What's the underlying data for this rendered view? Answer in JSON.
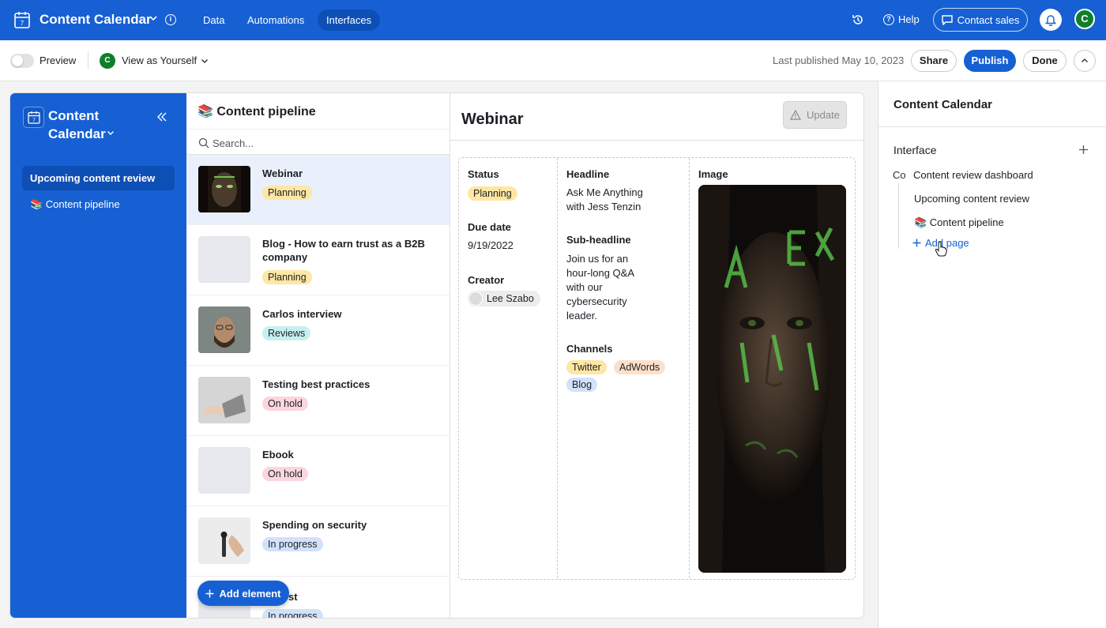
{
  "topbar": {
    "title": "Content Calendar",
    "nav": [
      "Data",
      "Automations",
      "Interfaces"
    ],
    "help_label": "Help",
    "contact_sales_label": "Contact sales",
    "avatar_initial": "C",
    "bg_color": "#1660d4"
  },
  "subbar": {
    "preview_label": "Preview",
    "avatar_initial": "C",
    "view_as_label": "View as Yourself",
    "last_published": "Last published May 10, 2023",
    "share_label": "Share",
    "publish_label": "Publish",
    "done_label": "Done"
  },
  "sidebar": {
    "title": "Content Calendar",
    "items": [
      {
        "label": "Upcoming content review",
        "active": true
      },
      {
        "label": "📚 Content pipeline",
        "active": false
      }
    ]
  },
  "list": {
    "title": "📚 Content pipeline",
    "search_placeholder": "Search...",
    "records": [
      {
        "name": "Webinar",
        "status": "Planning",
        "status_color": "#fde7a3",
        "thumb": "dark-face"
      },
      {
        "name": "Blog - How to earn trust as a B2B company",
        "status": "Planning",
        "status_color": "#fde7a3",
        "thumb": "placeholder"
      },
      {
        "name": "Carlos interview",
        "status": "Reviews",
        "status_color": "#c6f0ef",
        "thumb": "matrix-face"
      },
      {
        "name": "Testing best practices",
        "status": "On hold",
        "status_color": "#fbd6dd",
        "thumb": "laptop"
      },
      {
        "name": "Ebook",
        "status": "On hold",
        "status_color": "#fbd6dd",
        "thumb": "placeholder"
      },
      {
        "name": "Spending on security",
        "status": "In progress",
        "status_color": "#d1e2fb",
        "thumb": "key"
      },
      {
        "name": "st",
        "status": "In progress",
        "status_color": "#d1e2fb",
        "thumb": "placeholder"
      }
    ]
  },
  "add_element_label": "Add element",
  "detail": {
    "title": "Webinar",
    "update_label": "Update",
    "status_label": "Status",
    "status_value": "Planning",
    "due_date_label": "Due date",
    "due_date_value": "9/19/2022",
    "creator_label": "Creator",
    "creator_value": "Lee Szabo",
    "headline_label": "Headline",
    "headline_value": "Ask Me Anything with Jess Tenzin",
    "subheadline_label": "Sub-headline",
    "subheadline_value": "Join us for an hour-long Q&A with our cybersecurity leader.",
    "channels_label": "Channels",
    "channels": [
      {
        "label": "Twitter",
        "color": "#fde7a3"
      },
      {
        "label": "AdWords",
        "color": "#fde0c9"
      },
      {
        "label": "Blog",
        "color": "#d1e2fb"
      }
    ],
    "image_label": "Image"
  },
  "rpanel": {
    "title": "Content Calendar",
    "interface_label": "Interface",
    "co_label": "Co",
    "dashboard_label": "Content review dashboard",
    "pages": [
      "Upcoming content review",
      "📚 Content pipeline"
    ],
    "add_page_label": "Add page"
  }
}
